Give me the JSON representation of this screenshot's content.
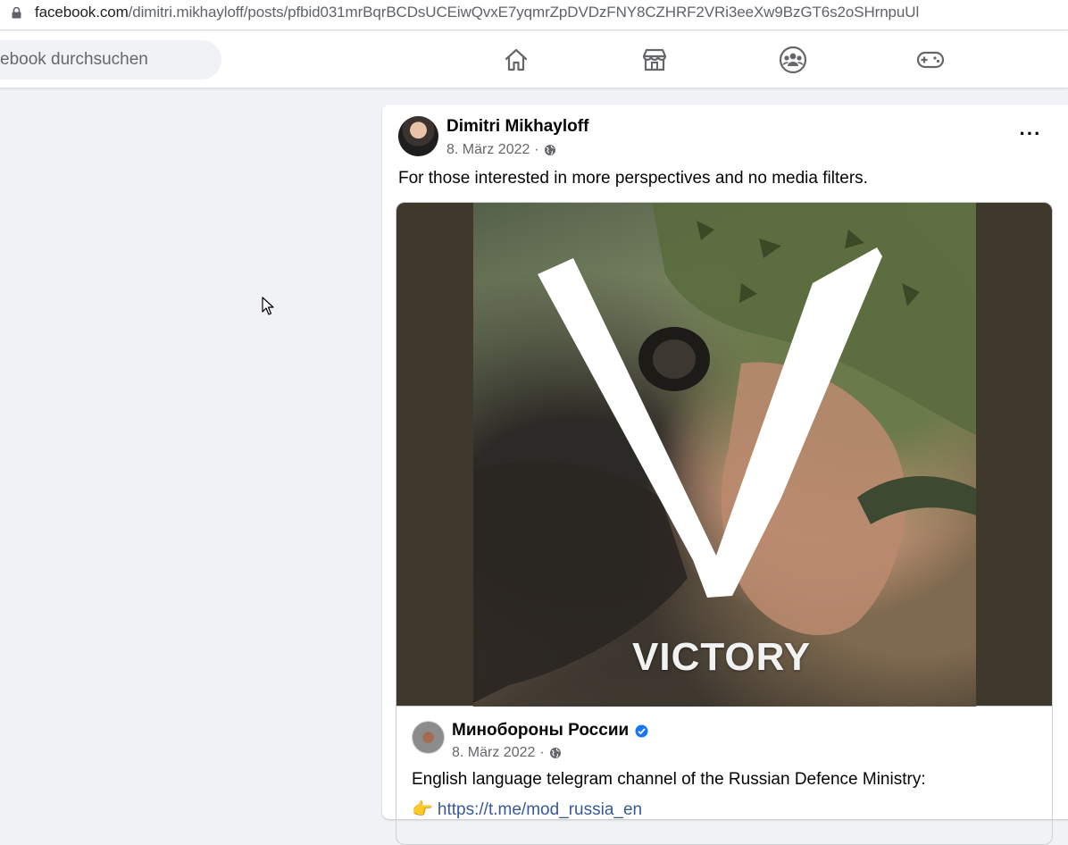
{
  "browser": {
    "url_host": "facebook.com",
    "url_path": "/dimitri.mikhayloff/posts/pfbid031mrBqrBCDsUCEiwQvxE7yqmrZpDVDzFNY8CZHRF2VRi3eeXw9BzGT6s2oSHrnpuUl"
  },
  "nav": {
    "search_placeholder": "ebook durchsuchen",
    "icons": [
      "home-icon",
      "marketplace-icon",
      "groups-icon",
      "gaming-icon"
    ]
  },
  "post": {
    "author": "Dimitri Mikhayloff",
    "date": "8. März 2022",
    "separator": "·",
    "audience_icon": "globe-icon",
    "more_label": "···",
    "text": "For those interested in more perspectives and no media filters.",
    "image_overlay_text": "VICTORY"
  },
  "shared_post": {
    "author": "Минобороны России",
    "verified_icon": "verified-badge-icon",
    "date": "8. März 2022",
    "separator": "·",
    "audience_icon": "globe-icon",
    "text": "English language telegram channel of the Russian Defence Ministry:",
    "link_text": "👉 https://t.me/mod_russia_en"
  },
  "colors": {
    "page_bg": "#f0f2f5",
    "card_bg": "#ffffff",
    "secondary_text": "#65676b",
    "link": "#385898",
    "verified": "#1877f2",
    "media_bg": "#3f382d"
  }
}
